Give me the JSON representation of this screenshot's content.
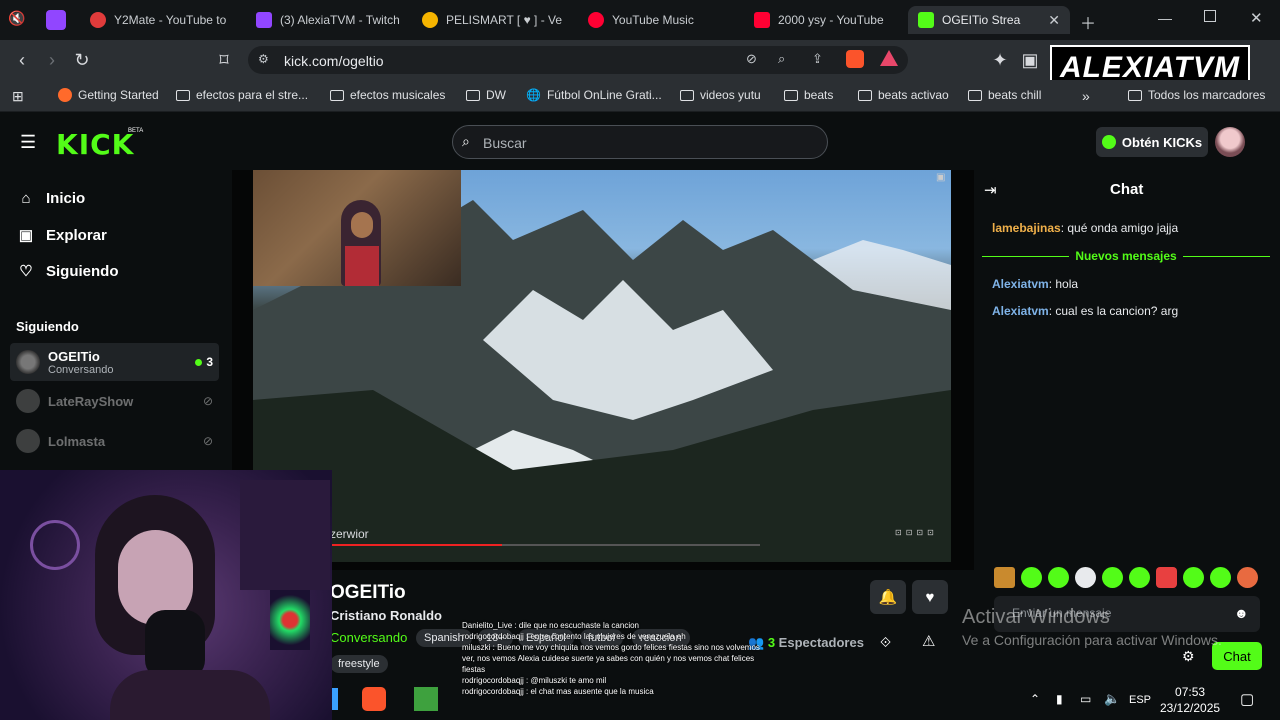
{
  "browser": {
    "tabs": [
      {
        "label": "Y2Mate - YouTube to",
        "icon": "y2mate-icon",
        "color": "#e03b3b"
      },
      {
        "label": "(3) AlexiaTVM - Twitch",
        "icon": "twitch-icon",
        "color": "#9146ff"
      },
      {
        "label": "PELISMART [ ♥ ] - Ve",
        "icon": "play-icon",
        "color": "#f5b400"
      },
      {
        "label": "YouTube Music",
        "icon": "youtube-music-icon",
        "color": "#ff0033"
      },
      {
        "label": "2000 ysy - YouTube",
        "icon": "youtube-icon",
        "color": "#ff0033"
      },
      {
        "label": "OGEITio Strea",
        "icon": "kick-icon",
        "color": "#53fc18"
      }
    ],
    "url": "kick.com/ogeltio",
    "bookmarks": [
      "Getting Started",
      "efectos para el stre...",
      "efectos musicales",
      "DW",
      "Fútbol OnLine Grati...",
      "videos yutu",
      "beats",
      "beats activao",
      "beats chill"
    ],
    "all_bookmarks": "Todos los marcadores",
    "brand_overlay": "ALEXIATVM"
  },
  "kick": {
    "logo": "KICK",
    "beta": "BETA",
    "search_placeholder": "Buscar",
    "get_kicks": "Obtén KICKs",
    "nav": [
      {
        "label": "Inicio",
        "icon": "home-icon"
      },
      {
        "label": "Explorar",
        "icon": "explore-icon"
      },
      {
        "label": "Siguiendo",
        "icon": "heart-icon"
      }
    ],
    "following_header": "Siguiendo",
    "channels": [
      {
        "name": "OGEITio",
        "sub": "Conversando",
        "viewers": "3",
        "live": true
      },
      {
        "name": "LateRayShow",
        "sub": "",
        "live": false
      },
      {
        "name": "Lolmasta",
        "sub": "",
        "live": false
      }
    ],
    "video_watermark": "zerwior"
  },
  "stream": {
    "title": "OGEITio",
    "subtitle": "Cristiano Ronaldo",
    "category": "Conversando",
    "tags": [
      "Spanish",
      "18+",
      "Español",
      "futbol",
      "reaccion",
      "freestyle"
    ],
    "viewers_count": "3",
    "viewers_label": "Espectadores"
  },
  "chat": {
    "header": "Chat",
    "messages_before": [
      {
        "user": "lamebajinas",
        "text": ": qué onda amigo jajja"
      }
    ],
    "new_messages_label": "Nuevos mensajes",
    "messages_after": [
      {
        "user": "Alexiatvm",
        "text": ": hola"
      },
      {
        "user": "Alexiatvm",
        "text": ": cual es la cancion? arg"
      }
    ],
    "input_placeholder": "Enviar un mensaje",
    "send_label": "Chat"
  },
  "overlay_chat": [
    "Danielito_Live : dile que no escuchaste la cancion",
    "rodrigocordobaqjj : entre contento las mujeres de venezuela eh",
    "miluszki : Bueno me voy chiquita nos vemos gordo felices fiestas sino nos volvemos ver, nos vemos Alexia cuidese suerte ya sabes con quién y nos vemos chat felices fiestas",
    "rodrigocordobaqjj : @miluszki te amo mil",
    "rodrigocordobaqjj : el chat mas ausente que la musica"
  ],
  "windows": {
    "activate_title": "Activar Windows",
    "activate_sub": "Ve a Configuración para activar Windows.",
    "language": "ESP",
    "time": "07:53",
    "date": "23/12/2025"
  }
}
